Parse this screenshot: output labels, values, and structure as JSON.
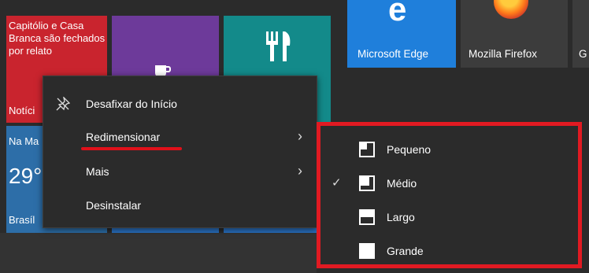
{
  "tiles": {
    "news": {
      "text": "Capitólio e Casa Branca são fechados por relato",
      "label": "Notíci"
    },
    "weather": {
      "city": "Na Ma",
      "temp": "29°",
      "country": "Brasíl"
    },
    "edge": {
      "label": "Microsoft Edge"
    },
    "firefox": {
      "label": "Mozilla Firefox"
    },
    "partial": {
      "label": "G"
    }
  },
  "context_menu": {
    "items": [
      {
        "label": "Desafixar do Início",
        "icon": "unpin-icon"
      },
      {
        "label": "Redimensionar",
        "has_submenu": true
      },
      {
        "label": "Mais",
        "has_submenu": true
      },
      {
        "label": "Desinstalar"
      }
    ]
  },
  "resize_submenu": {
    "items": [
      {
        "label": "Pequeno",
        "checked": false
      },
      {
        "label": "Médio",
        "checked": true
      },
      {
        "label": "Largo",
        "checked": false
      },
      {
        "label": "Grande",
        "checked": false
      }
    ]
  },
  "colors": {
    "highlight": "#e11a22",
    "menu_bg": "#2b2b2b"
  }
}
